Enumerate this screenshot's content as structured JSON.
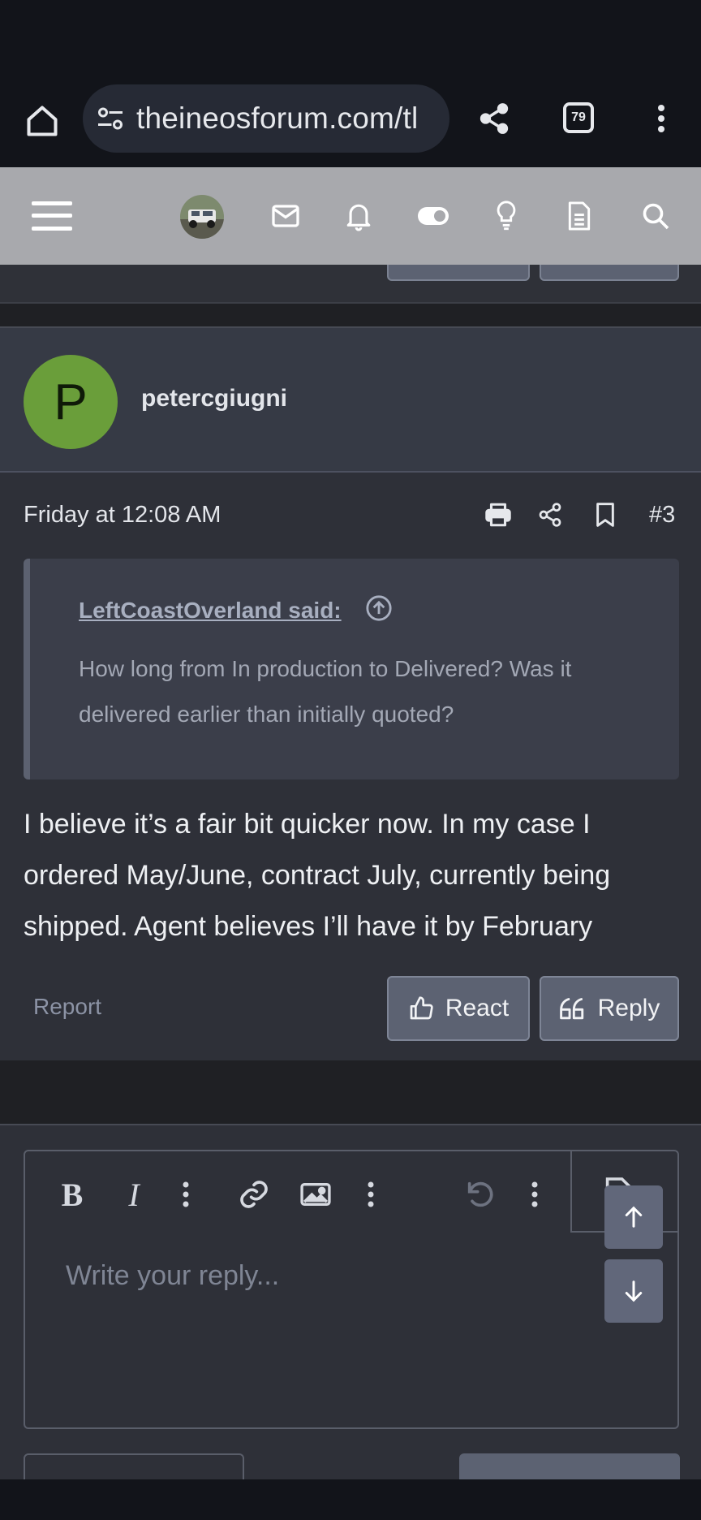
{
  "browser": {
    "url": "theineosforum.com/tl",
    "tab_count": "79"
  },
  "forum_nav": {
    "icons": [
      "menu-icon",
      "avatar",
      "mail-icon",
      "bell-icon",
      "toggle-icon",
      "lightbulb-icon",
      "document-icon",
      "search-icon"
    ]
  },
  "post": {
    "avatar_letter": "P",
    "username": "petercgiugni",
    "date": "Friday at 12:08 AM",
    "number": "#3",
    "quote": {
      "author": "LeftCoastOverland said:",
      "text": "How long from In production to Delivered? Was it delivered earlier than initially quoted?"
    },
    "body": "I believe it’s a fair bit quicker now. In my case I ordered May/June, contract July, currently being shipped. Agent believes I’ll have it by February",
    "report_label": "Report",
    "react_label": "React",
    "reply_label": "Reply"
  },
  "editor": {
    "bold_label": "B",
    "italic_label": "I",
    "placeholder": "Write your reply..."
  },
  "colors": {
    "page_bg": "#1f2024",
    "post_bg": "#2e3038",
    "header_bg": "#a8a9ad",
    "avatar_green": "#6a9e3a",
    "button_bg": "#5c6272"
  }
}
